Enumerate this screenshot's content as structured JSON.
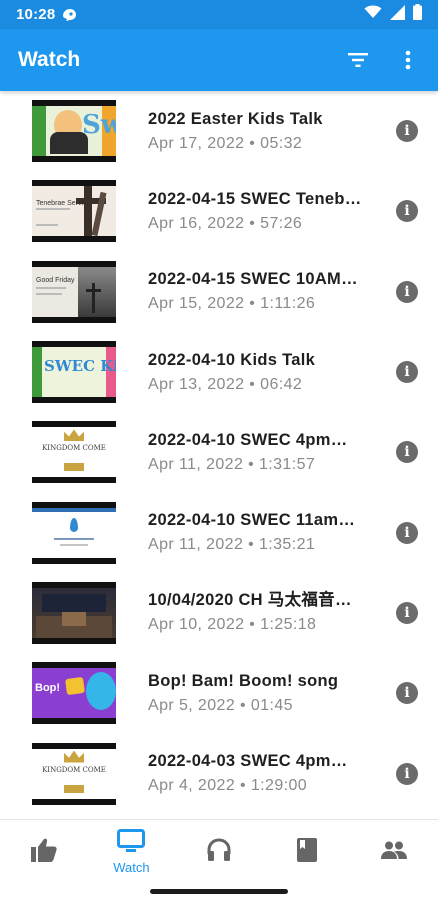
{
  "status_bar": {
    "time": "10:28"
  },
  "app_bar": {
    "title": "Watch"
  },
  "videos": [
    {
      "title": "2022 Easter Kids Talk",
      "date": "Apr 17, 2022",
      "duration": "05:32",
      "thumb_text": "Sw"
    },
    {
      "title": "2022-04-15 SWEC Teneb…",
      "date": "Apr 16, 2022",
      "duration": "57:26",
      "thumb_text": "Tenebrae Service"
    },
    {
      "title": "2022-04-15 SWEC 10AM…",
      "date": "Apr 15, 2022",
      "duration": "1:11:26",
      "thumb_text": "Good Friday"
    },
    {
      "title": "2022-04-10 Kids Talk",
      "date": "Apr 13, 2022",
      "duration": "06:42",
      "thumb_text": "SWEC Kids"
    },
    {
      "title": "2022-04-10 SWEC 4pm…",
      "date": "Apr 11, 2022",
      "duration": "1:31:57",
      "thumb_text": "KINGDOM COME"
    },
    {
      "title": "2022-04-10 SWEC 11am…",
      "date": "Apr 11, 2022",
      "duration": "1:35:21",
      "thumb_text": ""
    },
    {
      "title": "10/04/2020  CH 马太福音…",
      "date": "Apr 10, 2022",
      "duration": "1:25:18",
      "thumb_text": ""
    },
    {
      "title": "Bop! Bam! Boom! song",
      "date": "Apr 5, 2022",
      "duration": "01:45",
      "thumb_text": "Bop!"
    },
    {
      "title": "2022-04-03 SWEC 4pm…",
      "date": "Apr 4, 2022",
      "duration": "1:29:00",
      "thumb_text": "KINGDOM COME"
    }
  ],
  "meta_separator": "•",
  "bottom_nav": {
    "items": [
      {
        "icon": "thumbs-up-icon",
        "label": ""
      },
      {
        "icon": "monitor-icon",
        "label": "Watch",
        "active": true
      },
      {
        "icon": "headphones-icon",
        "label": ""
      },
      {
        "icon": "book-icon",
        "label": ""
      },
      {
        "icon": "people-icon",
        "label": ""
      }
    ]
  },
  "colors": {
    "primary": "#1e98ef",
    "status_bar": "#1a8be0",
    "inactive_icon": "#666666"
  }
}
